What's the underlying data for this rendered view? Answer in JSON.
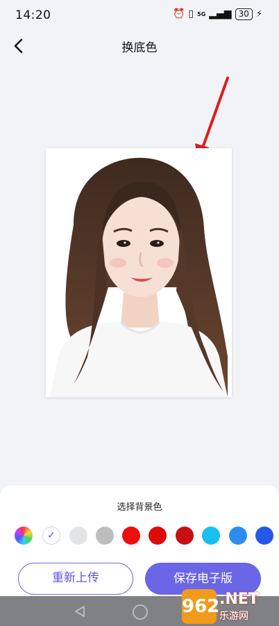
{
  "status_bar": {
    "time": "14:20",
    "network": "5G",
    "battery": "30"
  },
  "header": {
    "title": "换底色"
  },
  "panel": {
    "title": "选择背景色",
    "swatches": [
      {
        "name": "rainbow",
        "color": "conic"
      },
      {
        "name": "white",
        "color": "#ffffff",
        "selected": true
      },
      {
        "name": "light-gray",
        "color": "#e3e4e6"
      },
      {
        "name": "gray",
        "color": "#bdbdbe"
      },
      {
        "name": "red",
        "color": "#f10d0d"
      },
      {
        "name": "red-2",
        "color": "#de0a0a"
      },
      {
        "name": "dark-red",
        "color": "#c60e13"
      },
      {
        "name": "light-blue",
        "color": "#17c0ef"
      },
      {
        "name": "blue",
        "color": "#2d8cf0"
      },
      {
        "name": "royal-blue",
        "color": "#2557e8"
      }
    ],
    "reupload_label": "重新上传",
    "save_label": "保存电子版"
  },
  "watermark": {
    "logo_text": "962",
    "site_text": ".NET",
    "sub_text": "乐游网"
  }
}
